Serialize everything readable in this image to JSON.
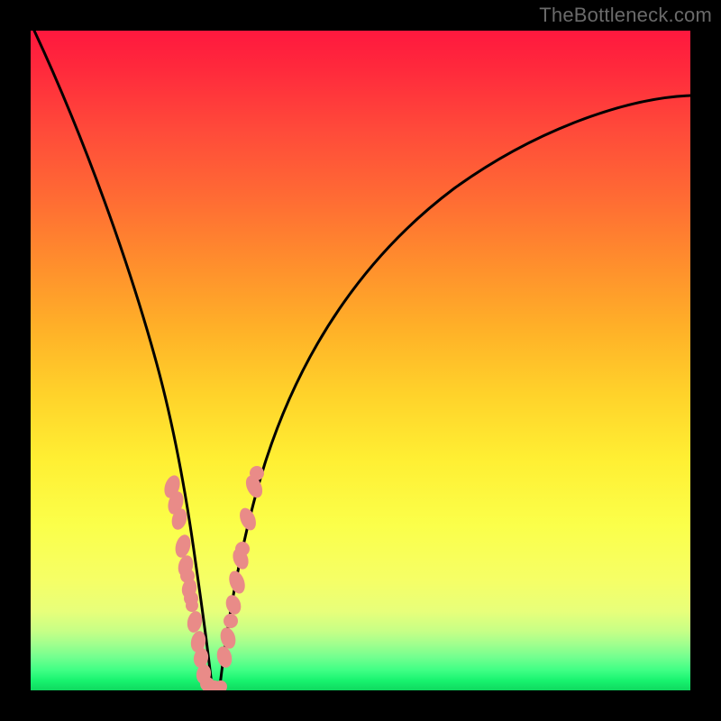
{
  "watermark": "TheBottleneck.com",
  "chart_data": {
    "type": "line",
    "title": "",
    "xlabel": "",
    "ylabel": "",
    "xlim": [
      0,
      100
    ],
    "ylim": [
      0,
      100
    ],
    "x": [
      0,
      5,
      10,
      15,
      18,
      20,
      22,
      23,
      24,
      25,
      26,
      27,
      28,
      29,
      30,
      32,
      34,
      36,
      40,
      45,
      50,
      55,
      60,
      65,
      70,
      75,
      80,
      85,
      90,
      95,
      100
    ],
    "values": [
      100,
      88,
      73,
      55,
      43,
      35,
      27,
      22,
      17,
      10,
      3,
      0,
      0,
      4,
      10,
      22,
      33,
      41,
      52,
      61,
      67,
      72,
      75,
      78,
      80,
      82,
      83.5,
      84.5,
      85.2,
      85.8,
      86
    ],
    "series": [
      {
        "name": "bottleneck-curve",
        "x": [
          0,
          5,
          10,
          15,
          18,
          20,
          22,
          23,
          24,
          25,
          26,
          27,
          28,
          29,
          30,
          32,
          34,
          36,
          40,
          45,
          50,
          55,
          60,
          65,
          70,
          75,
          80,
          85,
          90,
          95,
          100
        ],
        "y": [
          100,
          88,
          73,
          55,
          43,
          35,
          27,
          22,
          17,
          10,
          3,
          0,
          0,
          4,
          10,
          22,
          33,
          41,
          52,
          61,
          67,
          72,
          75,
          78,
          80,
          82,
          83.5,
          84.5,
          85.2,
          85.8,
          86
        ]
      }
    ],
    "markers_left_branch": [
      {
        "x": 21.2,
        "y": 31
      },
      {
        "x": 21.8,
        "y": 28.5
      },
      {
        "x": 22.3,
        "y": 26
      },
      {
        "x": 23.0,
        "y": 22
      },
      {
        "x": 23.5,
        "y": 19
      },
      {
        "x": 23.7,
        "y": 17.5
      },
      {
        "x": 24.0,
        "y": 15.5
      },
      {
        "x": 24.2,
        "y": 14
      },
      {
        "x": 24.4,
        "y": 13
      },
      {
        "x": 24.8,
        "y": 10.5
      },
      {
        "x": 25.3,
        "y": 7.5
      },
      {
        "x": 25.7,
        "y": 5
      },
      {
        "x": 26.2,
        "y": 2.5
      },
      {
        "x": 26.8,
        "y": 1
      }
    ],
    "markers_bottom": [
      {
        "x": 27.0,
        "y": 0.2
      },
      {
        "x": 27.5,
        "y": 0.2
      },
      {
        "x": 28.0,
        "y": 0.2
      },
      {
        "x": 28.6,
        "y": 0.5
      }
    ],
    "markers_right_branch": [
      {
        "x": 29.3,
        "y": 5
      },
      {
        "x": 29.8,
        "y": 8
      },
      {
        "x": 30.2,
        "y": 10.5
      },
      {
        "x": 30.6,
        "y": 13
      },
      {
        "x": 31.2,
        "y": 16.5
      },
      {
        "x": 31.8,
        "y": 20
      },
      {
        "x": 32.0,
        "y": 21.5
      },
      {
        "x": 32.8,
        "y": 26
      },
      {
        "x": 33.8,
        "y": 31
      },
      {
        "x": 34.2,
        "y": 33
      }
    ],
    "gradient_stops": [
      {
        "pos": 0,
        "label": "red"
      },
      {
        "pos": 50,
        "label": "orange"
      },
      {
        "pos": 70,
        "label": "yellow"
      },
      {
        "pos": 100,
        "label": "green"
      }
    ]
  }
}
